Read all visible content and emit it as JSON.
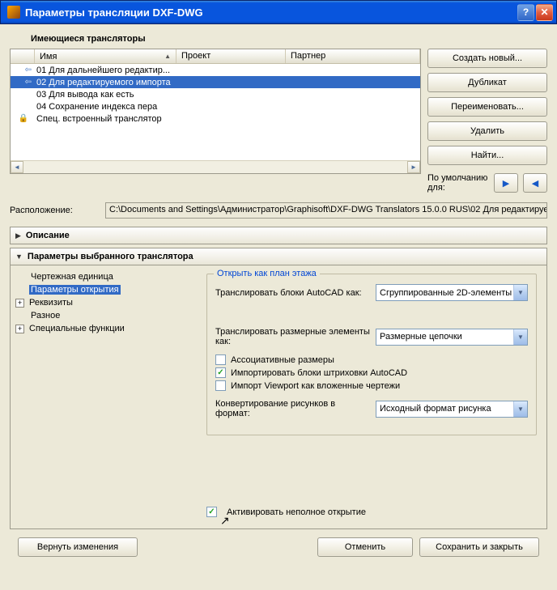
{
  "window": {
    "title": "Параметры трансляции DXF-DWG"
  },
  "section_label": "Имеющиеся трансляторы",
  "columns": {
    "name": "Имя",
    "project": "Проект",
    "partner": "Партнер"
  },
  "translators": [
    {
      "name": "01 Для дальнейшего редактир...",
      "icon": true
    },
    {
      "name": "02 Для редактируемого импорта",
      "icon": true,
      "selected": true
    },
    {
      "name": "03 Для вывода как есть"
    },
    {
      "name": "04 Сохранение индекса пера"
    },
    {
      "name": "Спец. встроенный транслятор",
      "locked": true
    }
  ],
  "buttons": {
    "create": "Создать новый...",
    "duplicate": "Дубликат",
    "rename": "Переименовать...",
    "delete": "Удалить",
    "find": "Найти..."
  },
  "default_for": "По умолчанию для:",
  "location_label": "Расположение:",
  "location_value": "C:\\Documents and Settings\\Администратор\\Graphisoft\\DXF-DWG Translators 15.0.0 RUS\\02 Для редактируемого и",
  "acc_desc": "Описание",
  "acc_params": "Параметры выбранного транслятора",
  "tree": {
    "drawing_unit": "Чертежная единица",
    "open_params": "Параметры открытия",
    "attributes": "Реквизиты",
    "misc": "Разное",
    "special": "Специальные функции"
  },
  "group_title": "Открыть как план этажа",
  "form": {
    "translate_blocks": "Транслировать блоки AutoCAD как:",
    "translate_blocks_val": "Сгруппированные 2D-элементы",
    "translate_dims": "Транслировать размерные элементы как:",
    "translate_dims_val": "Размерные цепочки",
    "chk_assoc": "Ассоциативные размеры",
    "chk_hatch": "Импортировать блоки штриховки AutoCAD",
    "chk_viewport": "Импорт Viewport как вложенные чертежи",
    "convert_pics": "Конвертирование рисунков в формат:",
    "convert_pics_val": "Исходный формат рисунка",
    "chk_partial": "Активировать неполное открытие"
  },
  "footer": {
    "revert": "Вернуть изменения",
    "cancel": "Отменить",
    "save": "Сохранить и закрыть"
  }
}
